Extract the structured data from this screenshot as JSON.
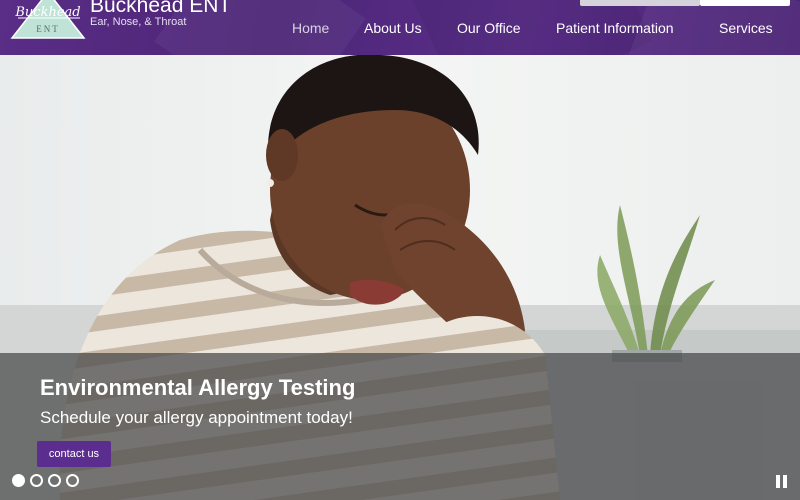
{
  "header": {
    "brand_name": "Buckhead ENT",
    "brand_tagline": "Ear, Nose, & Throat",
    "logo_script": "Buckhead",
    "logo_mark": "ENT"
  },
  "nav": {
    "items": [
      {
        "label": "Home"
      },
      {
        "label": "About Us"
      },
      {
        "label": "Our Office"
      },
      {
        "label": "Patient Information"
      },
      {
        "label": "Services"
      }
    ]
  },
  "hero": {
    "title": "Environmental Allergy Testing",
    "subtitle": "Schedule your allergy appointment today!",
    "cta_label": "contact us",
    "slide_count": 4,
    "active_slide": 1
  },
  "colors": {
    "brand_purple": "#5b2d8e",
    "header_purple": "#4b2576",
    "logo_mint": "#bfe3d6"
  },
  "icons": {
    "pause": "pause-icon",
    "logo": "triangle-logo-icon"
  }
}
